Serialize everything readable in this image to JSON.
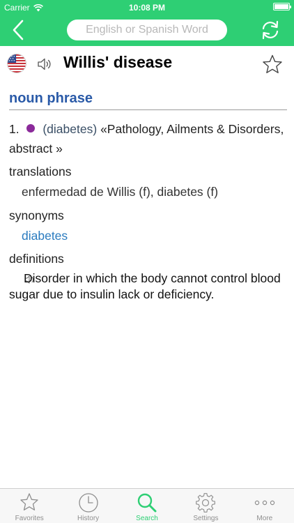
{
  "status_bar": {
    "carrier": "Carrier",
    "time": "10:08 PM"
  },
  "header": {
    "search_placeholder": "English or Spanish Word",
    "accent_color": "#2ecf74",
    "icons": [
      "chevron-left-icon",
      "refresh-icon"
    ]
  },
  "entry": {
    "word": "Willis' disease",
    "language_flag": "us-flag-icon",
    "part_of_speech": "noun phrase",
    "sense": {
      "number": "1.",
      "context": "(diabetes)",
      "domain": "«Pathology, Ailments & Disorders, abstract »"
    },
    "translations_label": "translations",
    "translations": "enfermedad de Willis (f), diabetes (f)",
    "synonyms_label": "synonyms",
    "synonyms": "diabetes",
    "definitions_label": "definitions",
    "definition": "Disorder in which the body cannot control blood sugar due to insulin lack or deficiency."
  },
  "tabbar": {
    "items": [
      {
        "label": "Favorites",
        "icon": "star-icon"
      },
      {
        "label": "History",
        "icon": "clock-icon"
      },
      {
        "label": "Search",
        "icon": "search-icon",
        "active": true
      },
      {
        "label": "Settings",
        "icon": "gear-icon"
      },
      {
        "label": "More",
        "icon": "more-icon"
      }
    ]
  }
}
